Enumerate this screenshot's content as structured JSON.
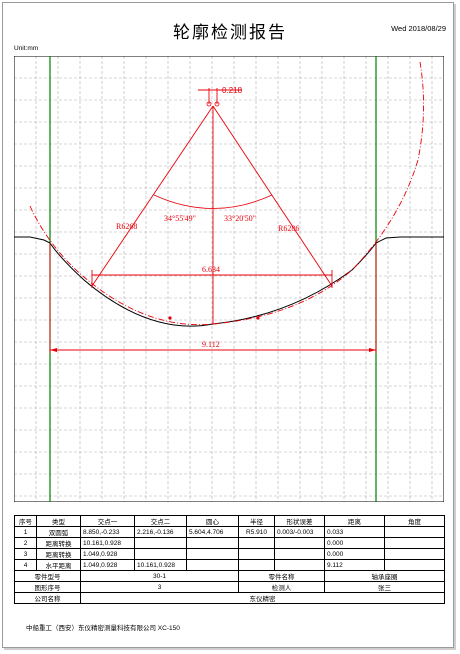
{
  "header": {
    "title": "轮廓检测报告",
    "date": "Wed 2018/08/29",
    "unit": "Unit:mm"
  },
  "plot": {
    "dims": {
      "top": "0.218",
      "left_angle": "34°55'49\"",
      "right_angle": "33°20'50\"",
      "left_radius": "R6268",
      "right_radius": "R6286",
      "inner_width": "6.634",
      "outer_width": "9.112"
    },
    "colors": {
      "dimension": "#e8000b",
      "guide": "#008000",
      "grid": "#b0b0b0",
      "profile": "#000000"
    }
  },
  "table": {
    "headers": [
      "序号",
      "类型",
      "交点一",
      "交点二",
      "圆心",
      "半径",
      "形状误差",
      "距离",
      "角度"
    ],
    "rows": [
      [
        "1",
        "双圆弧",
        "8.850,-0.233",
        "2.216,-0.136",
        "5.604,4.706",
        "R5.910",
        "0.003/-0.003",
        "0.033",
        ""
      ],
      [
        "2",
        "距离转换",
        "10.161,0.928",
        "",
        "",
        "",
        "",
        "0.000",
        ""
      ],
      [
        "3",
        "距离转换",
        "1.049,0.928",
        "",
        "",
        "",
        "",
        "0.000",
        ""
      ],
      [
        "4",
        "水平距离",
        "1.049,0.928",
        "10.161,0.928",
        "",
        "",
        "",
        "9.112",
        ""
      ]
    ],
    "info": {
      "item_label": "零件型号",
      "item_value": "30-1",
      "part_name_label": "零件名称",
      "part_name_value": "轴承座圈",
      "drawing_label": "图形序号",
      "drawing_value": "3",
      "inspector_label": "检测人",
      "inspector_value": "张三",
      "company_label": "公司名称",
      "company_value": "东仪精密"
    }
  },
  "footer": {
    "text": "中船重工（西安）东仪精密测量科技有限公司 XC-150"
  }
}
